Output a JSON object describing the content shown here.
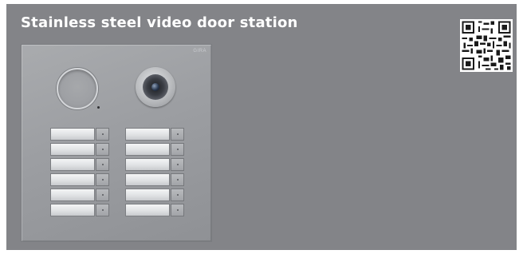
{
  "header": {
    "title": "Stainless steel video door station"
  },
  "product": {
    "brand_mark": "GIRA",
    "bell_buttons_per_column": 6,
    "bell_columns": 2
  },
  "colors": {
    "background": "#838488",
    "title_text": "#ffffff"
  },
  "icons": {
    "qr": "qr-code-icon",
    "camera": "camera-lens-icon",
    "microphone": "microphone-icon"
  }
}
